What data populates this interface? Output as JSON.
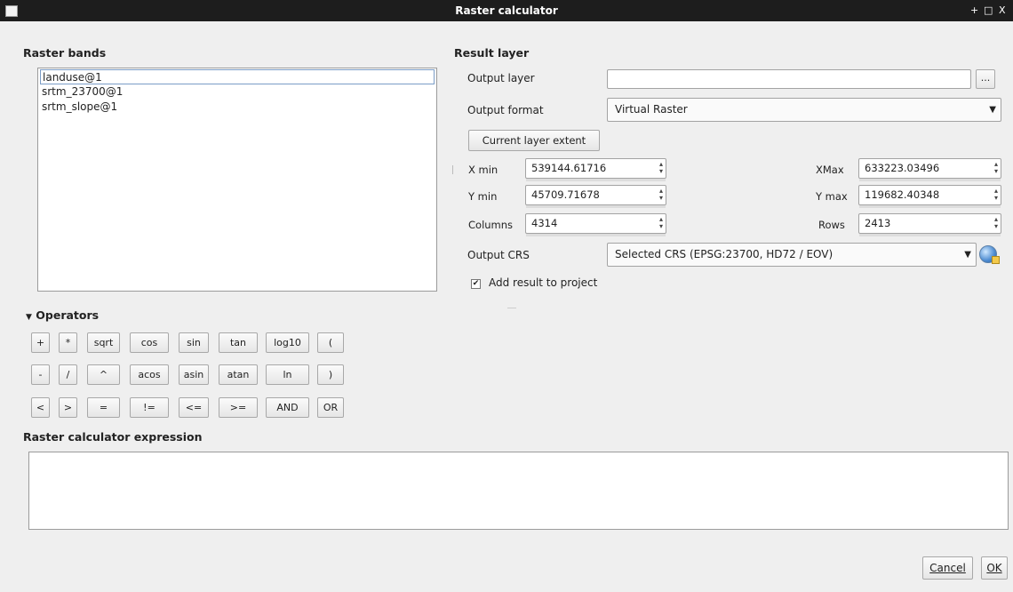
{
  "window": {
    "title": "Raster calculator",
    "controls": [
      "+",
      "□",
      "X"
    ]
  },
  "raster_bands": {
    "heading": "Raster bands",
    "items": [
      "landuse@1",
      "srtm_23700@1",
      "srtm_slope@1"
    ]
  },
  "result_layer": {
    "heading": "Result layer",
    "output_layer_label": "Output layer",
    "output_layer_value": "",
    "browse_label": "...",
    "output_format_label": "Output format",
    "output_format_value": "Virtual Raster",
    "current_extent_label": "Current layer extent",
    "xmin_label": "X min",
    "xmin_value": "539144.61716",
    "xmax_label": "XMax",
    "xmax_value": "633223.03496",
    "ymin_label": "Y min",
    "ymin_value": "45709.71678",
    "ymax_label": "Y max",
    "ymax_value": "119682.40348",
    "columns_label": "Columns",
    "columns_value": "4314",
    "rows_label": "Rows",
    "rows_value": "2413",
    "crs_label": "Output CRS",
    "crs_value": "Selected CRS (EPSG:23700, HD72 / EOV)",
    "add_result_label": "Add result to project",
    "add_result_checked": true
  },
  "operators": {
    "heading": "Operators",
    "row1": [
      "+",
      "*",
      "sqrt",
      "cos",
      "sin",
      "tan",
      "log10",
      "("
    ],
    "row2": [
      "-",
      "/",
      "^",
      "acos",
      "asin",
      "atan",
      "ln",
      ")"
    ],
    "row3": [
      "<",
      ">",
      "=",
      "!=",
      "<=",
      ">=",
      "AND",
      "OR"
    ]
  },
  "expression": {
    "heading": "Raster calculator expression",
    "value": ""
  },
  "footer": {
    "cancel_label": "Cancel",
    "ok_label": "OK"
  },
  "colors": {
    "titlebar": "#1d1d1d",
    "dialog_bg": "#efefef",
    "field_bg": "#ffffff",
    "border": "#a3a3a3"
  }
}
